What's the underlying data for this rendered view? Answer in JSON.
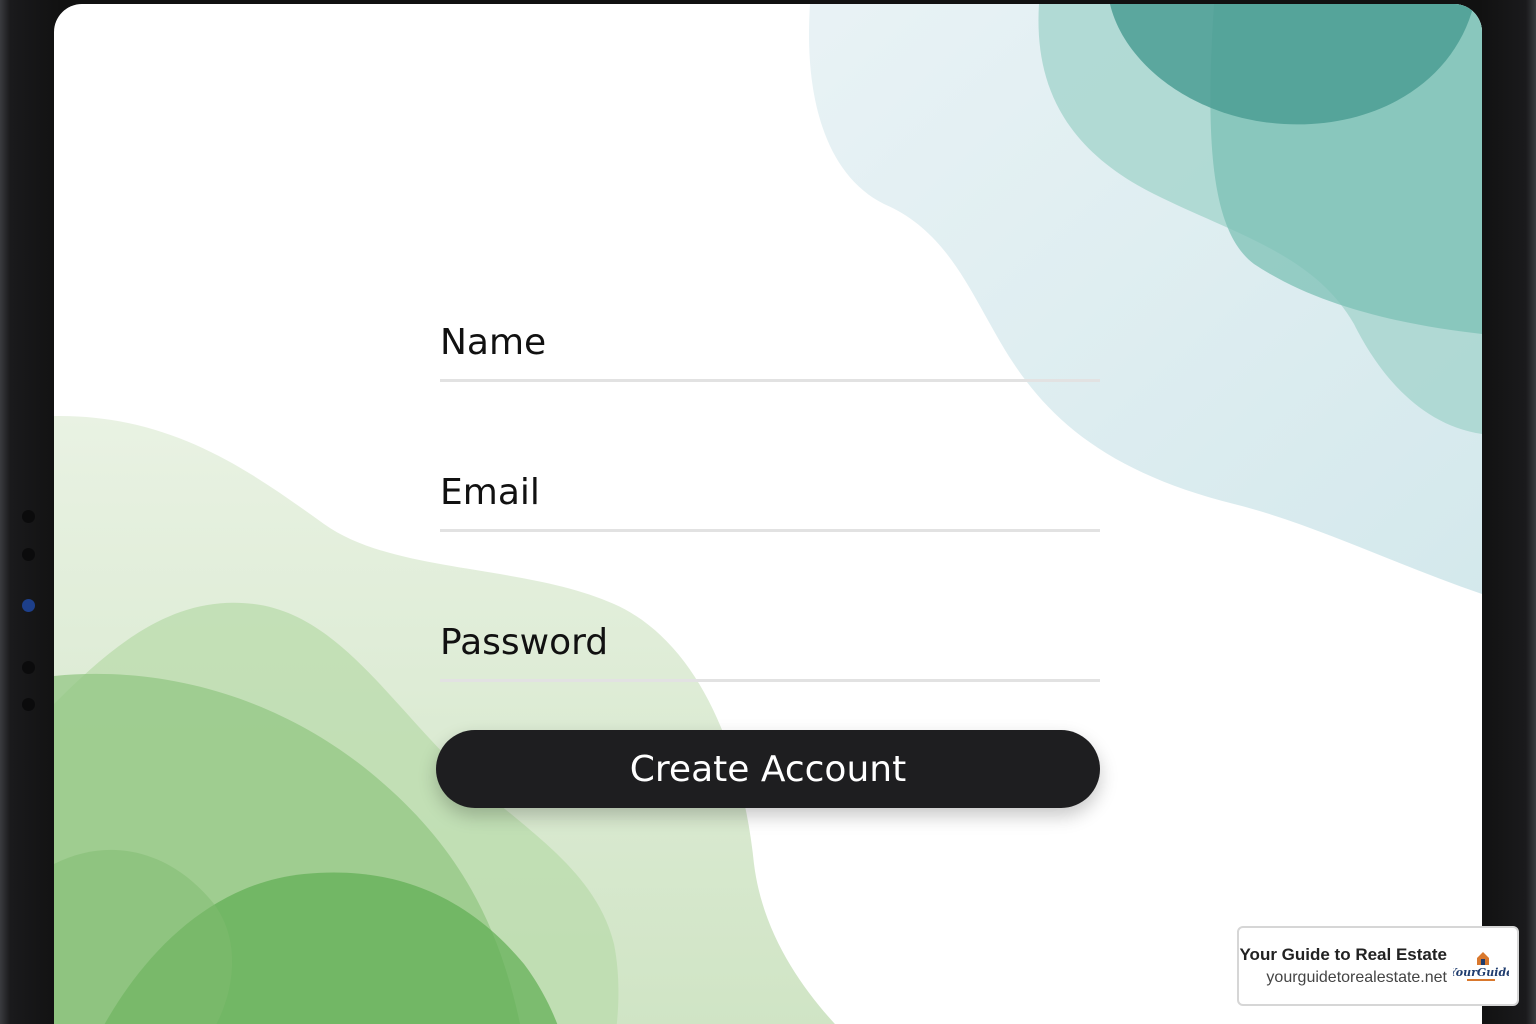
{
  "form": {
    "name_placeholder": "Name",
    "email_placeholder": "Email",
    "password_placeholder": "Password",
    "submit_label": "Create Account"
  },
  "watermark": {
    "title": "Your Guide to Real Estate",
    "url": "yourguidetorealestate.net",
    "logo_text": "YourGuide"
  },
  "colors": {
    "button_bg": "#1e1e20",
    "accent_teal": "#3f9f92",
    "accent_green": "#4aa044"
  }
}
